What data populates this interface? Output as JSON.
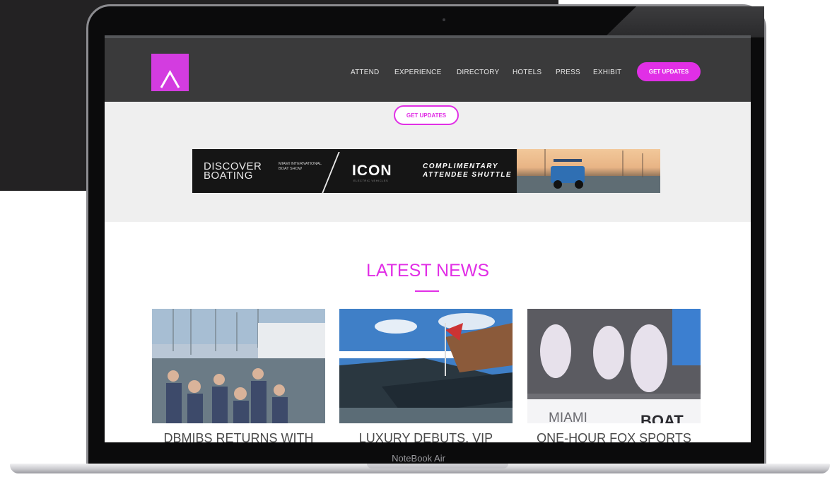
{
  "browser": {
    "nav": {
      "items": [
        "ATTEND",
        "EXPERIENCE",
        "DIRECTORY",
        "HOTELS",
        "PRESS",
        "EXHIBIT"
      ],
      "cta": "GET UPDATES"
    }
  },
  "hero": {
    "button": "GET UPDATES"
  },
  "banner": {
    "discover": "DISCOVER BOATING",
    "show": "MIAMI INTERNATIONAL BOAT SHOW",
    "brand": "ICON",
    "brand_sub": "ELECTRIC VEHICLES",
    "headline": "COMPLIMENTARY",
    "subline": "ATTENDEE SHUTTLE"
  },
  "news": {
    "heading": "LATEST NEWS",
    "cards": [
      {
        "title": "DBMIBS RETURNS WITH",
        "image": "crowded-docks-photo"
      },
      {
        "title": "LUXURY DEBUTS, VIP",
        "image": "yacht-marina-photo"
      },
      {
        "title": "ONE-HOUR FOX SPORTS",
        "image": "stage-performers-photo",
        "stage_sign": "MIAMI",
        "stage_sign_2": "BOAT"
      }
    ]
  },
  "device": {
    "label": "NoteBook Air"
  },
  "colors": {
    "accent": "#e12fe6",
    "nav_bg": "#3a3a3b",
    "band_bg": "#efefef",
    "backdrop": "#232223"
  }
}
